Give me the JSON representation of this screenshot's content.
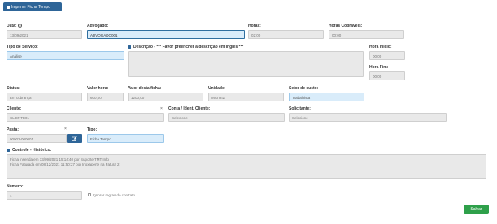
{
  "toolbar": {
    "print_label": "Imprimir Ficha Tempo"
  },
  "fields": {
    "data": {
      "label": "Data:",
      "help": "?",
      "value": "13/09/2021"
    },
    "advogado": {
      "label": "Advogado:",
      "value": "ADVOGADO001"
    },
    "horas": {
      "label": "Horas:",
      "value": "02:00"
    },
    "horas_cobraveis": {
      "label": "Horas Cobráveis:",
      "value": "00:00"
    },
    "tipo_servico": {
      "label": "Tipo de Serviço:",
      "value": "Análise"
    },
    "descricao": {
      "label": "Descrição - *** Favor preencher a descrição em Inglês ***",
      "value": ""
    },
    "hora_inicio": {
      "label": "Hora Início:",
      "value": "00:00"
    },
    "hora_fim": {
      "label": "Hora Fim:",
      "value": "00:00"
    },
    "status": {
      "label": "Status:",
      "value": "Em cobrança"
    },
    "valor_hora": {
      "label": "Valor hora:",
      "value": "600,00"
    },
    "valor_ficha": {
      "label": "Valor desta ficha:",
      "value": "1200,00"
    },
    "unidade": {
      "label": "Unidade:",
      "value": "MATRIZ"
    },
    "setor_custo": {
      "label": "Setor de custo:",
      "value": "Trabalhista"
    },
    "cliente": {
      "label": "Cliente:",
      "value": "CLIENTE01",
      "clear": "×"
    },
    "conta": {
      "label": "Conta / Ident. Cliente:",
      "value": "Selecione"
    },
    "solicitante": {
      "label": "Solicitante:",
      "value": "Selecione"
    },
    "pasta": {
      "label": "Pasta:",
      "value": "00002-000001",
      "clear": "×"
    },
    "tipo": {
      "label": "Tipo:",
      "value": "Ficha Tempo"
    },
    "controle": {
      "label": "Controle - Histórico:",
      "lines": [
        "Ficha inserida em 13/09/2021 15:14:40 por Suporte TMT Info",
        "Ficha Faturada em 08/12/2021 11:50:27 por Inoxaperte na Fatura 2"
      ]
    },
    "numero": {
      "label": "Número:",
      "value": "1"
    },
    "ignorar": {
      "label": "Ignorar regras do contrato"
    }
  },
  "actions": {
    "save_label": "Salvar"
  },
  "colors": {
    "primary": "#2e6598",
    "success": "#2ea04a",
    "field_bg": "#e9e9e9",
    "selected_bg": "#d9ecfa"
  }
}
